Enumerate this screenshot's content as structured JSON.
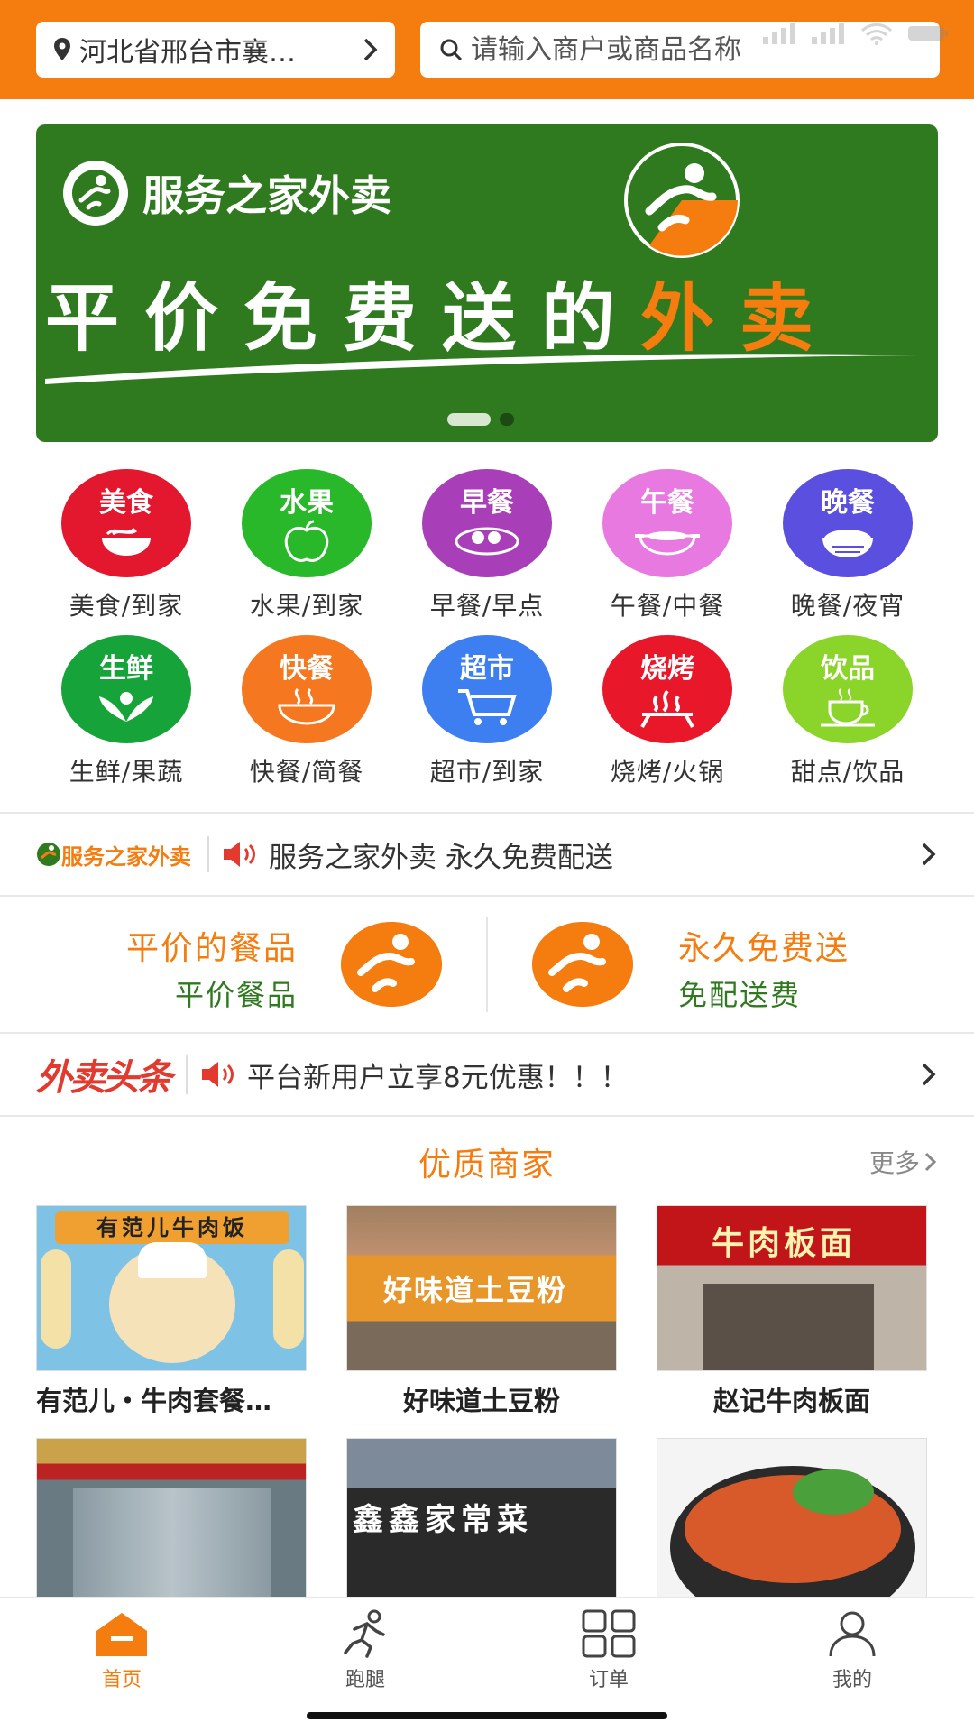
{
  "header": {
    "location": "河北省邢台市襄…",
    "search_placeholder": "请输入商户或商品名称",
    "accent_color": "#f57c0f"
  },
  "banner": {
    "brand": "服务之家外卖",
    "slogan_main": "平价免费送的",
    "slogan_accent": "外卖",
    "background_color": "#2f7a1f",
    "slide_count": 2,
    "active_slide": 1
  },
  "categories": [
    {
      "icon_text": "美食",
      "label": "美食/到家",
      "color": "#e3172d",
      "icon": "noodle-bowl-icon"
    },
    {
      "icon_text": "水果",
      "label": "水果/到家",
      "color": "#28b82a",
      "icon": "apple-icon"
    },
    {
      "icon_text": "早餐",
      "label": "早餐/早点",
      "color": "#a83fb8",
      "icon": "bun-steamer-icon"
    },
    {
      "icon_text": "午餐",
      "label": "午餐/中餐",
      "color": "#e879e0",
      "icon": "hotpot-icon"
    },
    {
      "icon_text": "晚餐",
      "label": "晚餐/夜宵",
      "color": "#5b4fe0",
      "icon": "rice-bowl-icon"
    },
    {
      "icon_text": "生鲜",
      "label": "生鲜/果蔬",
      "color": "#16a33a",
      "icon": "vegetable-icon"
    },
    {
      "icon_text": "快餐",
      "label": "快餐/简餐",
      "color": "#f5771f",
      "icon": "soup-bowl-icon"
    },
    {
      "icon_text": "超市",
      "label": "超市/到家",
      "color": "#3d7ff0",
      "icon": "shopping-cart-icon"
    },
    {
      "icon_text": "烧烤",
      "label": "烧烤/火锅",
      "color": "#e8172a",
      "icon": "grill-icon"
    },
    {
      "icon_text": "饮品",
      "label": "甜点/饮品",
      "color": "#8bd42a",
      "icon": "coffee-cup-icon"
    }
  ],
  "notice1": {
    "logo_text": "服务之家外卖",
    "text": "服务之家外卖 永久免费配送"
  },
  "promo": {
    "left_title": "平价的餐品",
    "left_sub": "平价餐品",
    "right_title": "永久免费送",
    "right_sub": "免配送费"
  },
  "notice2": {
    "logo_text": "外卖头条",
    "text": "平台新用户立享8元优惠！！！"
  },
  "merchants_section": {
    "title": "优质商家",
    "more": "更多"
  },
  "merchants": [
    {
      "name": "有范儿・牛肉套餐…",
      "sign": "有范儿牛肉饭"
    },
    {
      "name": "好味道土豆粉",
      "sign": "好味道土豆粉"
    },
    {
      "name": "赵记牛肉板面",
      "sign": "牛肉板面"
    },
    {
      "name": "",
      "sign": ""
    },
    {
      "name": "",
      "sign": "鑫鑫家常菜"
    },
    {
      "name": "",
      "sign": ""
    }
  ],
  "tabbar": {
    "tabs": [
      {
        "label": "首页",
        "icon": "home-icon",
        "active": true
      },
      {
        "label": "跑腿",
        "icon": "runner-icon",
        "active": false
      },
      {
        "label": "订单",
        "icon": "grid-icon",
        "active": false
      },
      {
        "label": "我的",
        "icon": "user-icon",
        "active": false
      }
    ]
  }
}
